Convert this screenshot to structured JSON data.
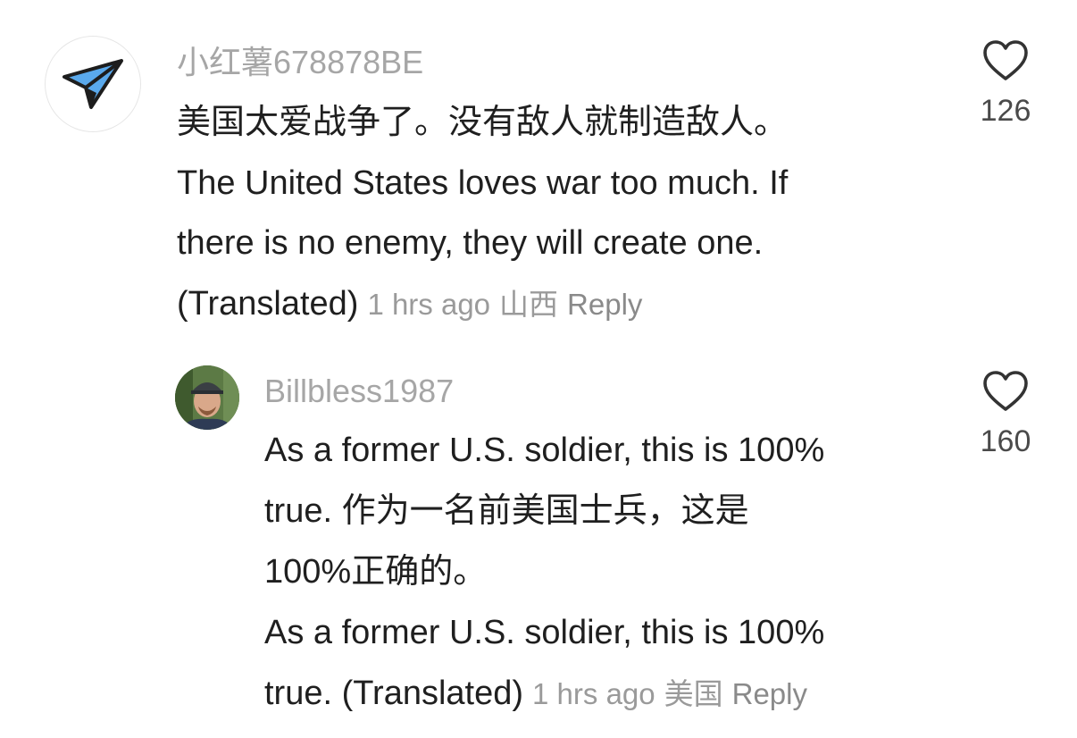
{
  "comments": [
    {
      "username": "小红薯678878BE",
      "avatar_icon": "paper-plane-icon",
      "lines": [
        "美国太爱战争了。没有敌人就制造敌人。",
        "The United States loves war too much. If",
        "there is no enemy, they will create one.",
        "(Translated)"
      ],
      "time": "1 hrs ago",
      "location": "山西",
      "reply_label": "Reply",
      "like_count": "126"
    },
    {
      "username": "Billbless1987",
      "avatar_icon": "user-photo-avatar",
      "lines": [
        "As a former U.S. soldier, this is 100%",
        "true.  作为一名前美国士兵，这是",
        "100%正确的。",
        "As a former U.S. soldier, this is 100%",
        "true. (Translated)"
      ],
      "time": "1 hrs ago",
      "location": "美国",
      "reply_label": "Reply",
      "like_count": "160"
    }
  ],
  "colors": {
    "username": "#a6a6a6",
    "text": "#1f1f1f",
    "meta": "#9a9a9a",
    "plane_blue": "#5aa9ec"
  }
}
